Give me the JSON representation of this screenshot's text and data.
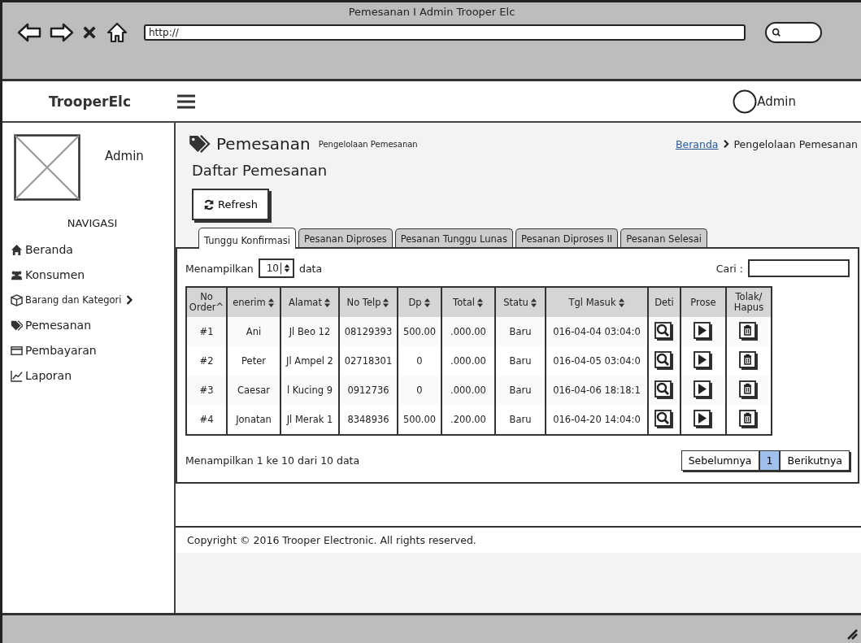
{
  "window": {
    "title": "Pemesanan I Admin Trooper Elc",
    "url": "http://"
  },
  "header": {
    "brand": "TrooperElc",
    "user": "Admin"
  },
  "sidebar": {
    "user": "Admin",
    "section": "NAVIGASI",
    "items": [
      {
        "label": "Beranda",
        "kind": "home",
        "submenu": false
      },
      {
        "label": "Konsumen",
        "kind": "users",
        "submenu": false
      },
      {
        "label": "Barang dan Kategori",
        "kind": "box",
        "submenu": true
      },
      {
        "label": "Pemesanan",
        "kind": "tag",
        "submenu": false
      },
      {
        "label": "Pembayaran",
        "kind": "card",
        "submenu": false
      },
      {
        "label": "Laporan",
        "kind": "chart",
        "submenu": false
      }
    ]
  },
  "page": {
    "title": "Pemesanan",
    "subtitle": "Pengelolaan Pemesanan",
    "breadcrumb": {
      "link": "Beranda",
      "current": "Pengelolaan Pemesanan"
    },
    "heading": "Daftar Pemesanan",
    "refresh": "Refresh"
  },
  "tabs": [
    {
      "label": "Tunggu Konfirmasi",
      "selected": true
    },
    {
      "label": "Pesanan Diproses",
      "selected": false
    },
    {
      "label": "Pesanan Tunggu Lunas",
      "selected": false
    },
    {
      "label": "Pesanan Diproses II",
      "selected": false
    },
    {
      "label": "Pesanan Selesai",
      "selected": false
    }
  ],
  "length": {
    "prefix": "Menampilkan",
    "value": "10",
    "suffix": "data"
  },
  "search": {
    "label": "Cari :"
  },
  "table": {
    "columns": [
      {
        "label": "No Order^",
        "sort": false
      },
      {
        "label": "enerim",
        "sort": true
      },
      {
        "label": "Alamat",
        "sort": true
      },
      {
        "label": "No Telp",
        "sort": true
      },
      {
        "label": "Dp",
        "sort": true
      },
      {
        "label": "Total",
        "sort": true
      },
      {
        "label": "Statu",
        "sort": true
      },
      {
        "label": "Tgl Masuk",
        "sort": true
      },
      {
        "label": "Deti",
        "sort": false
      },
      {
        "label": "Prose",
        "sort": false
      },
      {
        "label": "Tolak/ Hapus",
        "sort": false
      }
    ],
    "rows": [
      {
        "cells": [
          "#1",
          "Ani",
          "Jl Beo 12",
          "08129393",
          "500.00",
          ".000.00",
          "Baru",
          "016-04-04 03:04:0"
        ]
      },
      {
        "cells": [
          "#2",
          "Peter",
          "Jl Ampel 2",
          "02718301",
          "0",
          ".000.00",
          "Baru",
          "016-04-05 03:04:0"
        ]
      },
      {
        "cells": [
          "#3",
          "Caesar",
          "l Kucing 9",
          "0912736",
          "0",
          ".000.00",
          "Baru",
          "016-04-06 18:18:1"
        ]
      },
      {
        "cells": [
          "#4",
          "Jonatan",
          "Jl Merak 1",
          "8348936",
          "500.00",
          ".200.00",
          "Baru",
          "016-04-20 14:04:0"
        ]
      }
    ]
  },
  "info": "Menampilkan 1 ke 10 dari 10 data",
  "pagination": {
    "previous": "Sebelumnya",
    "pages": [
      {
        "label": "1",
        "selected": true
      }
    ],
    "next": "Berikutnya"
  },
  "footer": "Copyright © 2016 Trooper Electronic. All rights reserved."
}
